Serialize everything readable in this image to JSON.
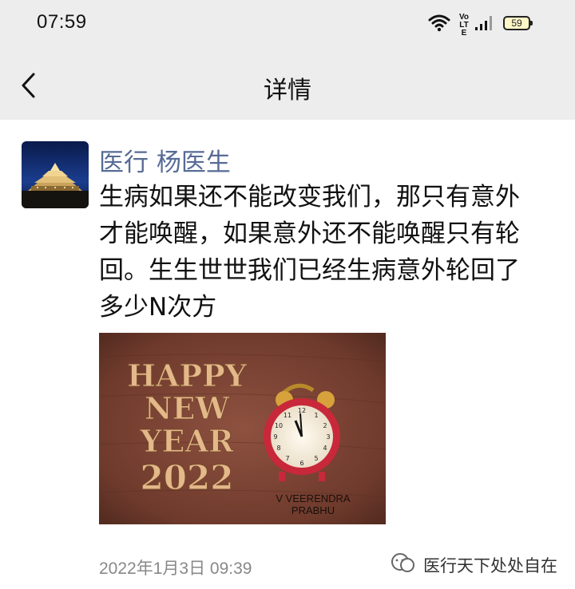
{
  "status_bar": {
    "time": "07:59",
    "network_label": "Vo LTE",
    "battery_level": "59",
    "icons": [
      "wifi-icon",
      "volte-icon",
      "signal-icon",
      "battery-icon"
    ]
  },
  "nav": {
    "title": "详情",
    "back_icon": "chevron-left-icon"
  },
  "post": {
    "author": "医行 杨医生",
    "text": "生病如果还不能改变我们，那只有意外才能唤醒，如果意外还不能唤醒只有轮回。生生世世我们已经生病意外轮回了多少N次方",
    "image": {
      "line1": "HAPPY",
      "line2": "NEW",
      "line3": "YEAR",
      "line4": "2022",
      "credit1": "V VEERENDRA",
      "credit2": "PRABHU"
    },
    "timestamp": "2022年1月3日 09:39"
  },
  "watermark": {
    "text": "医行天下处处自在",
    "icon": "wechat-official-account-icon"
  },
  "colors": {
    "bar_bg": "#ededed",
    "name_link": "#576b95",
    "timestamp": "#888888"
  }
}
